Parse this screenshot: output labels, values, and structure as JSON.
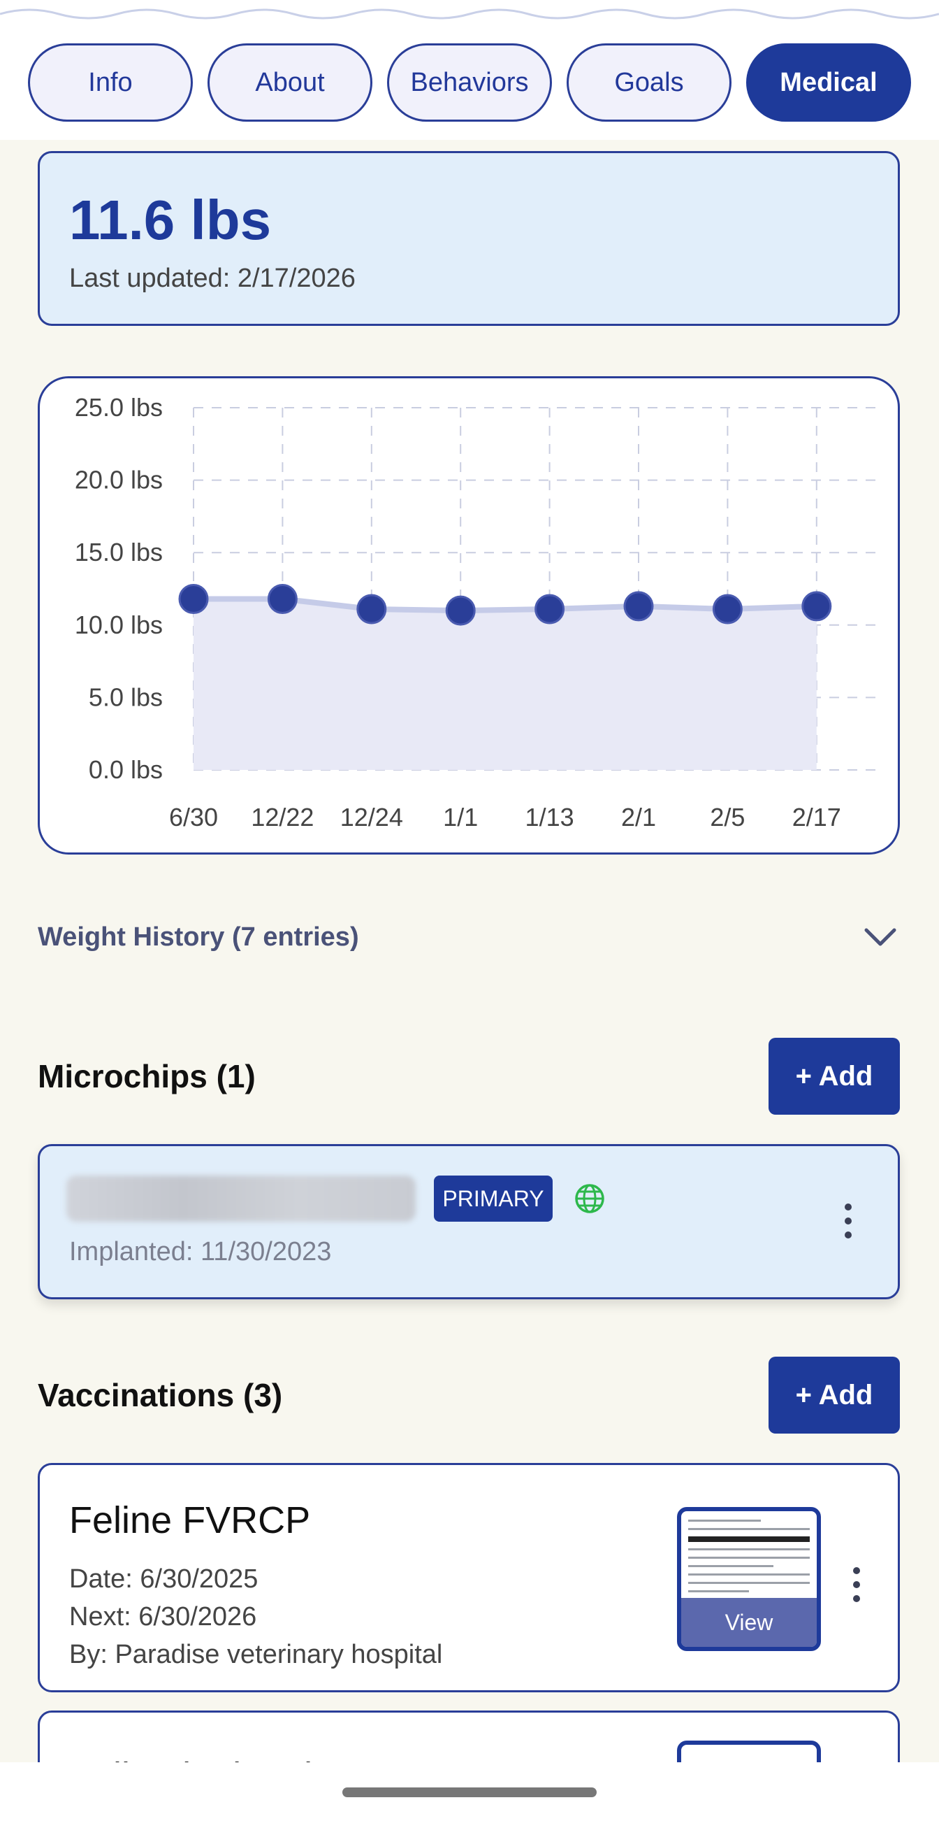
{
  "tabs": [
    {
      "label": "Info"
    },
    {
      "label": "About"
    },
    {
      "label": "Behaviors"
    },
    {
      "label": "Goals"
    },
    {
      "label": "Medical",
      "active": true
    }
  ],
  "weight": {
    "value": "11.6 lbs",
    "updated": "Last updated: 2/17/2026"
  },
  "chart_data": {
    "type": "area",
    "title": "",
    "xlabel": "",
    "ylabel": "",
    "categories": [
      "6/30",
      "12/22",
      "12/24",
      "1/1",
      "1/13",
      "2/1",
      "2/5",
      "2/17"
    ],
    "values": [
      11.8,
      11.8,
      11.1,
      11.0,
      11.1,
      11.3,
      11.1,
      11.3
    ],
    "y_ticks": [
      "0.0 lbs",
      "5.0 lbs",
      "10.0 lbs",
      "15.0 lbs",
      "20.0 lbs",
      "25.0 lbs"
    ],
    "ylim": [
      0,
      25
    ],
    "grid": true,
    "colors": {
      "line": "#c5cbe8",
      "point": "#2a3e98",
      "fill": "#e8e9f6"
    }
  },
  "history": {
    "label": "Weight History (7 entries)",
    "icon": "chevron-down-icon"
  },
  "microchips": {
    "title": "Microchips (1)",
    "add_label": "+ Add",
    "items": [
      {
        "badge": "PRIMARY",
        "implanted": "Implanted: 11/30/2023",
        "icon": "globe-icon"
      }
    ]
  },
  "vaccinations": {
    "title": "Vaccinations (3)",
    "add_label": "+ Add",
    "items": [
      {
        "name": "Feline FVRCP",
        "date": "Date: 6/30/2025",
        "next": "Next: 6/30/2026",
        "by": "By: Paradise veterinary hospital",
        "view_label": "View"
      },
      {
        "name": "Feline leukemia"
      }
    ]
  },
  "colors": {
    "accent": "#1e3a9a",
    "background": "#f8f7ef",
    "card_tint": "#e1eefa",
    "globe": "#2db84b"
  }
}
